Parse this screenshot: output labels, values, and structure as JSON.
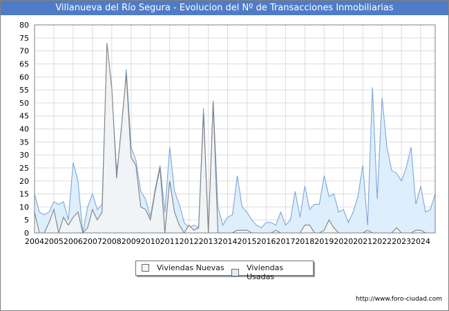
{
  "header": {
    "title": "Villanueva del Río Segura - Evolucion del Nº de Transacciones Inmobiliarias"
  },
  "footer": {
    "source": "http://www.foro-ciudad.com"
  },
  "chart_data": {
    "type": "area",
    "title": "Villanueva del Río Segura - Evolucion del Nº de Transacciones Inmobiliarias",
    "xlabel": "",
    "ylabel": "",
    "ylim": [
      0,
      80
    ],
    "yticks": [
      0,
      5,
      10,
      15,
      20,
      25,
      30,
      35,
      40,
      45,
      50,
      55,
      60,
      65,
      70,
      75,
      80
    ],
    "xlim": [
      2004,
      2024.75
    ],
    "xticks": [
      2004,
      2005,
      2006,
      2007,
      2008,
      2009,
      2010,
      2011,
      2012,
      2013,
      2014,
      2015,
      2016,
      2017,
      2018,
      2019,
      2020,
      2021,
      2022,
      2023,
      2024
    ],
    "grid": true,
    "legend_position": "bottom-center",
    "x_step": "quarterly",
    "x_start": 2004,
    "series": [
      {
        "name": "Viviendas Nuevas",
        "color": "#7f7f7f",
        "fill": "#f5f5f5",
        "values": [
          8,
          0,
          0,
          4,
          9,
          0,
          6,
          3,
          6,
          8,
          0,
          2,
          9,
          5,
          8,
          73,
          56,
          21,
          41,
          61,
          29,
          26,
          10,
          9,
          5,
          16,
          25,
          0,
          20,
          8,
          3,
          0,
          3,
          1,
          2,
          46,
          0,
          50,
          0,
          0,
          0,
          0,
          1,
          1,
          1,
          0,
          0,
          0,
          0,
          0,
          1,
          0,
          0,
          0,
          0,
          0,
          3,
          3,
          0,
          0,
          1,
          5,
          2,
          0,
          0,
          0,
          0,
          0,
          0,
          1,
          0,
          0,
          0,
          0,
          0,
          2,
          0,
          0,
          0,
          1,
          1,
          0,
          0,
          0
        ]
      },
      {
        "name": "Viviendas Usadas",
        "color": "#7ea6d8",
        "fill": "#ddeefc",
        "values": [
          15,
          8,
          7,
          8,
          12,
          11,
          12,
          5,
          27,
          20,
          0,
          10,
          15,
          9,
          11,
          68,
          54,
          24,
          36,
          63,
          33,
          28,
          16,
          13,
          6,
          17,
          26,
          8,
          33,
          16,
          11,
          4,
          2,
          3,
          2,
          48,
          0,
          51,
          10,
          3,
          6,
          7,
          22,
          10,
          8,
          5,
          3,
          2,
          4,
          4,
          3,
          8,
          3,
          5,
          16,
          6,
          18,
          9,
          11,
          11,
          22,
          14,
          15,
          8,
          9,
          4,
          8,
          14,
          26,
          3,
          56,
          13,
          52,
          33,
          24,
          23,
          20,
          25,
          33,
          11,
          18,
          8,
          9,
          15
        ]
      }
    ]
  }
}
